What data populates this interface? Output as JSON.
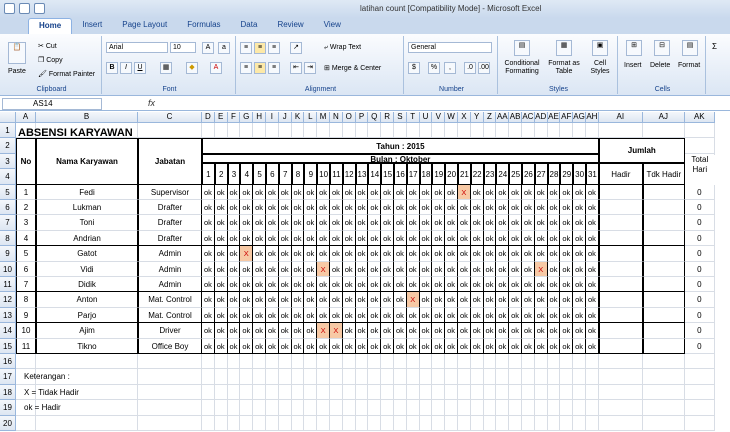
{
  "window": {
    "title": "latihan count  [Compatibility Mode]  -  Microsoft Excel"
  },
  "tabs": [
    "Home",
    "Insert",
    "Page Layout",
    "Formulas",
    "Data",
    "Review",
    "View"
  ],
  "ribbon": {
    "clipboard": {
      "label": "Clipboard",
      "paste": "Paste",
      "cut": "Cut",
      "copy": "Copy",
      "format_painter": "Format Painter"
    },
    "font": {
      "label": "Font",
      "name": "Arial",
      "size": "10",
      "bold": "B",
      "italic": "I",
      "underline": "U"
    },
    "alignment": {
      "label": "Alignment",
      "wrap": "Wrap Text",
      "merge": "Merge & Center"
    },
    "number": {
      "label": "Number",
      "format": "General",
      "currency": "$",
      "percent": "%",
      "comma": ","
    },
    "styles": {
      "label": "Styles",
      "conditional": "Conditional Formatting",
      "format_table": "Format as Table",
      "cell_styles": "Cell Styles"
    },
    "cells": {
      "label": "Cells",
      "insert": "Insert",
      "delete": "Delete",
      "format": "Format"
    }
  },
  "formula": {
    "name_box": "AS14",
    "fx": "fx"
  },
  "columns": [
    "A",
    "B",
    "C",
    "D",
    "E",
    "F",
    "G",
    "H",
    "I",
    "J",
    "K",
    "L",
    "M",
    "N",
    "O",
    "P",
    "Q",
    "R",
    "S",
    "T",
    "U",
    "V",
    "W",
    "X",
    "Y",
    "Z",
    "AA",
    "AB",
    "AC",
    "AD",
    "AE",
    "AF",
    "AG",
    "AH",
    "AI",
    "AJ",
    "AK"
  ],
  "sheet": {
    "title": "ABSENSI KARYAWAN",
    "header_no": "No",
    "header_nama": "Nama Karyawan",
    "header_jabatan": "Jabatan",
    "header_tahun": "Tahun : 2015",
    "header_bulan": "Bulan : Oktober",
    "header_jumlah": "Jumlah",
    "header_hadir": "Hadir",
    "header_tdk": "Tdk Hadir",
    "header_total": "Total Hari",
    "employees": [
      {
        "no": "1",
        "nama": "Fedi",
        "jabatan": "Supervisor",
        "absent": [
          21
        ],
        "total": "0"
      },
      {
        "no": "2",
        "nama": "Lukman",
        "jabatan": "Drafter",
        "absent": [],
        "total": "0"
      },
      {
        "no": "3",
        "nama": "Toni",
        "jabatan": "Drafter",
        "absent": [],
        "total": "0"
      },
      {
        "no": "4",
        "nama": "Andrian",
        "jabatan": "Drafter",
        "absent": [],
        "total": "0"
      },
      {
        "no": "5",
        "nama": "Gatot",
        "jabatan": "Admin",
        "absent": [
          4
        ],
        "total": "0"
      },
      {
        "no": "6",
        "nama": "Vidi",
        "jabatan": "Admin",
        "absent": [
          10,
          27
        ],
        "total": "0"
      },
      {
        "no": "7",
        "nama": "Didik",
        "jabatan": "Admin",
        "absent": [],
        "total": "0"
      },
      {
        "no": "8",
        "nama": "Anton",
        "jabatan": "Mat. Control",
        "absent": [
          17
        ],
        "total": "0"
      },
      {
        "no": "9",
        "nama": "Parjo",
        "jabatan": "Mat. Control",
        "absent": [],
        "total": "0"
      },
      {
        "no": "10",
        "nama": "Ajim",
        "jabatan": "Driver",
        "absent": [
          10,
          11
        ],
        "total": "0"
      },
      {
        "no": "11",
        "nama": "Tikno",
        "jabatan": "Office Boy",
        "absent": [],
        "total": "0"
      }
    ],
    "ok_mark": "ok",
    "absent_mark": "X",
    "notes": [
      "Keterangan :",
      "X = Tidak Hadir",
      "ok = Hadir"
    ]
  }
}
